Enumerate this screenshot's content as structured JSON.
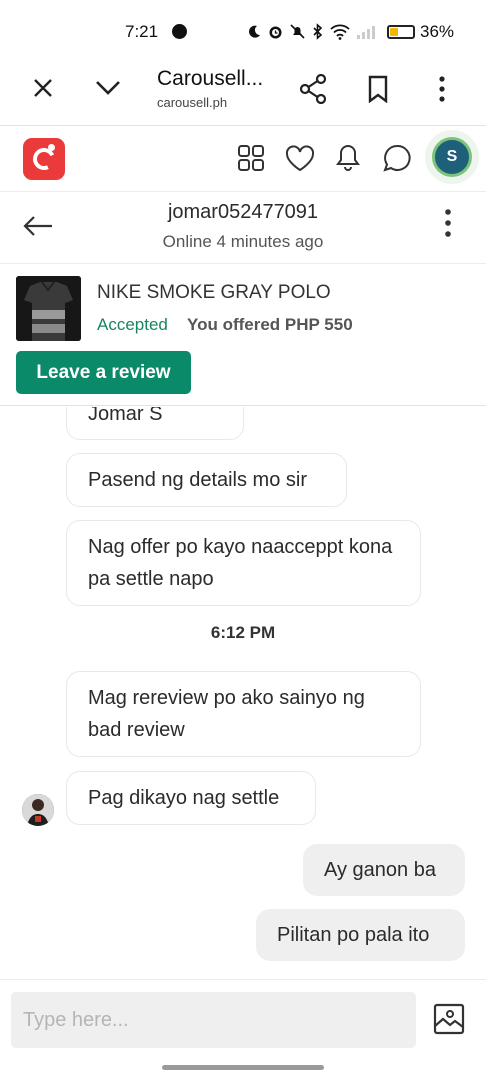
{
  "status_bar": {
    "time": "7:21",
    "battery": "36%",
    "battery_level": 0.36
  },
  "browser": {
    "title": "Carousell...",
    "url": "carousell.ph",
    "icons": [
      "close-icon",
      "chevron-down-icon",
      "share-icon",
      "bookmark-icon",
      "more-vert-icon"
    ]
  },
  "app_header": {
    "icons": [
      "carousell-logo",
      "grid-icon",
      "heart-icon",
      "bell-icon",
      "chat-icon"
    ],
    "avatar_initial": "S"
  },
  "chat": {
    "username": "jomar052477091",
    "status": "Online 4 minutes ago"
  },
  "listing": {
    "title": "NIKE SMOKE GRAY POLO",
    "status": "Accepted",
    "offer": "You offered PHP 550",
    "review_button": "Leave a review"
  },
  "messages": {
    "partial_name": "Jomar S",
    "items": [
      {
        "text": "Pasend ng details mo sir",
        "direction": "in"
      },
      {
        "text": "Nag offer po kayo naacceppt kona pa settle napo",
        "direction": "in"
      },
      {
        "text": "Mag rereview po ako sainyo ng bad review",
        "direction": "in"
      },
      {
        "text": "Pag dikayo nag settle",
        "direction": "in"
      },
      {
        "text": "Ay ganon ba",
        "direction": "out"
      },
      {
        "text": "Pilitan po pala ito",
        "direction": "out"
      }
    ],
    "time_separator": "6:12 PM"
  },
  "compose": {
    "placeholder": "Type here..."
  },
  "colors": {
    "accent_green": "#0b8a69",
    "accepted_green": "#19865f",
    "logo_red": "#ea3a3a"
  }
}
